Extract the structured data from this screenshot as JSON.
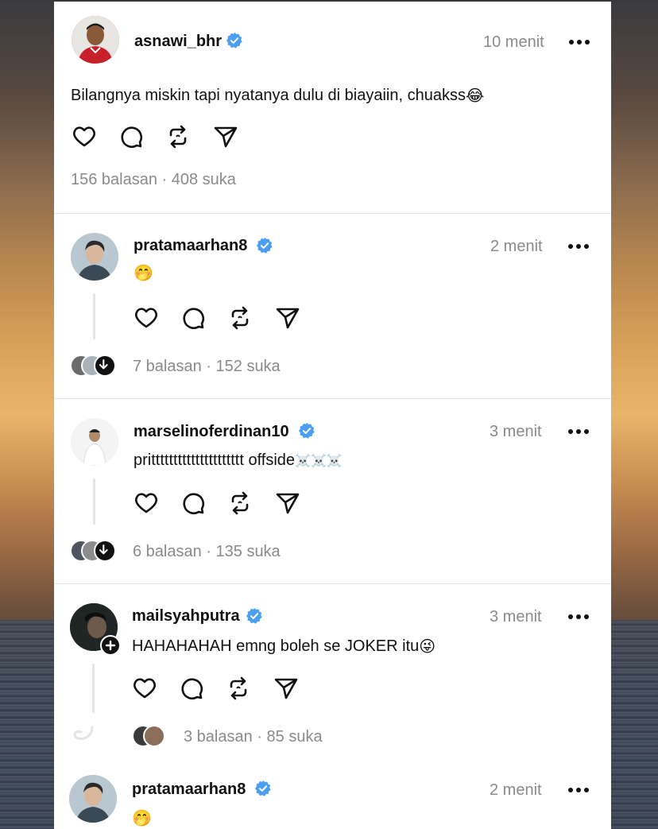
{
  "posts": [
    {
      "username": "asnawi_bhr",
      "time": "10 menit",
      "text": "Bilangnya miskin tapi nyatanya dulu di biayaiin, chuakss",
      "text_emoji": "😂",
      "stats": "156 balasan · 408 suka"
    },
    {
      "username": "pratamaarhan8",
      "time": "2 menit",
      "text": "",
      "text_emoji": "🤭",
      "stats": "7 balasan · 152 suka"
    },
    {
      "username": "marselinoferdinan10",
      "time": "3 menit",
      "text": "prittttttttttttttttttttt offside",
      "text_emoji": "☠️☠️☠️",
      "stats": "6 balasan · 135 suka"
    },
    {
      "username": "mailsyahputra",
      "time": "3 menit",
      "text": "HAHAHAHAH emng boleh se JOKER itu",
      "text_emoji": "😜",
      "stats": "3 balasan · 85 suka"
    },
    {
      "username": "pratamaarhan8",
      "time": "2 menit",
      "text": "",
      "text_emoji": "🤭",
      "stats": ""
    }
  ],
  "icons": {
    "like": "heart-icon",
    "reply": "comment-icon",
    "repost": "repost-icon",
    "share": "send-icon",
    "verified": "verified-badge-icon",
    "more": "more-icon",
    "follow": "plus-icon",
    "expand": "arrow-down-icon"
  },
  "colors": {
    "verified": "#4a9ff5",
    "muted": "#8a8a8a",
    "text": "#111111"
  }
}
